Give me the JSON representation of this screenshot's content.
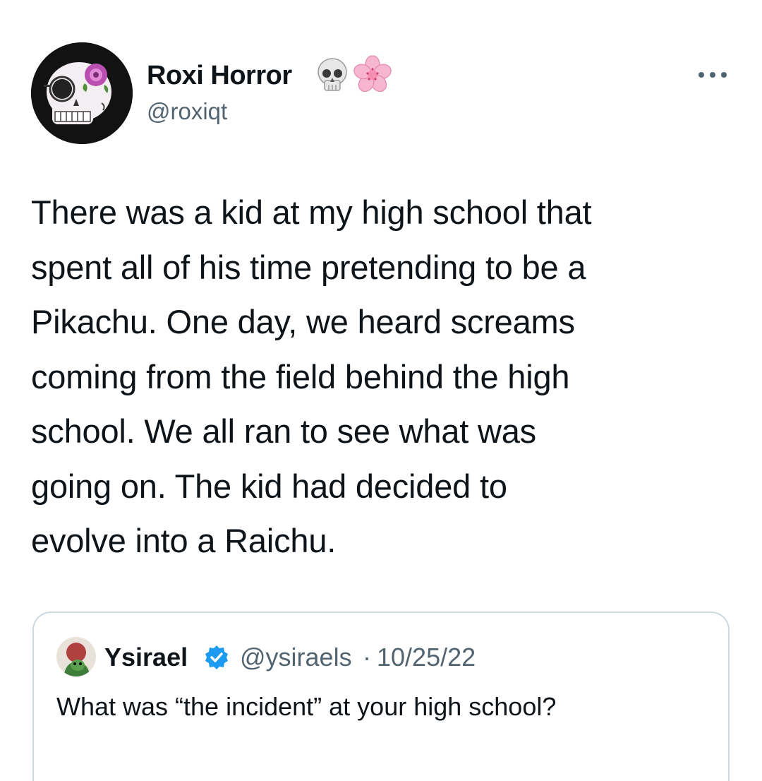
{
  "author": {
    "display_name": "Roxi Horror",
    "handle": "@roxiqt",
    "name_emojis": [
      "skull-emoji",
      "cherry-blossom-emoji"
    ]
  },
  "tweet": {
    "lines": [
      "There was a kid at my high school that",
      "spent all of his time pretending to be a",
      "Pikachu. One day, we heard screams",
      "coming from the field behind the high",
      "school. We all ran to see what was",
      "going on. The kid had decided to",
      "evolve into a Raichu."
    ]
  },
  "quoted_tweet": {
    "display_name": "Ysirael",
    "handle": "@ysiraels",
    "separator": "·",
    "date": "10/25/22",
    "text": "What was “the incident” at your high school?",
    "verified": true
  },
  "colors": {
    "text": "#0f1419",
    "secondary": "#536471",
    "verified": "#1d9bf0",
    "border": "#cfd9de"
  },
  "icons": {
    "more": "more-horizontal-icon",
    "verified": "verified-badge-icon"
  }
}
